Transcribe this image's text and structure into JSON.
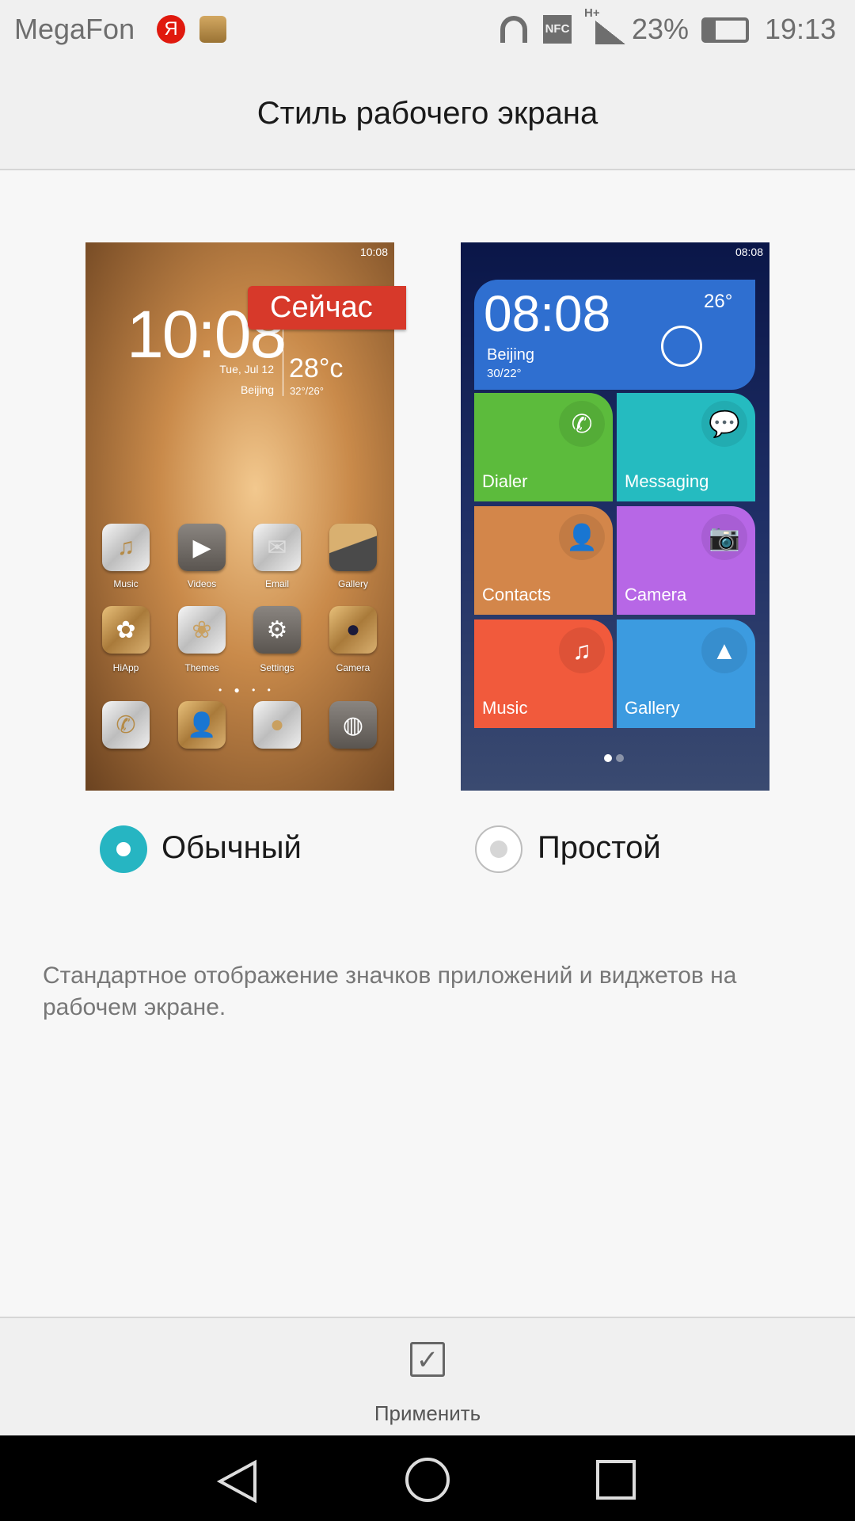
{
  "status_bar": {
    "carrier": "MegaFon",
    "yandex_badge": "Я",
    "battery": "23%",
    "network": "H+",
    "nfc": "NFC",
    "time": "19:13"
  },
  "header": {
    "title": "Стиль рабочего экрана"
  },
  "options": [
    {
      "label": "Обычный",
      "selected": true,
      "badge": "Сейчас",
      "preview": {
        "status_time": "10:08",
        "clock": "10:08",
        "date": "Tue, Jul 12",
        "city": "Beijing",
        "temp": "28°c",
        "range": "32°/26°",
        "apps": [
          "Music",
          "Videos",
          "Email",
          "Gallery",
          "HiApp",
          "Themes",
          "Settings",
          "Camera"
        ]
      }
    },
    {
      "label": "Простой",
      "selected": false,
      "preview": {
        "status_time": "08:08",
        "clock": "08:08",
        "city": "Beijing",
        "range": "30/22°",
        "temp": "26°",
        "tiles": [
          {
            "label": "Dialer",
            "color": "#5cbb3c"
          },
          {
            "label": "Messaging",
            "color": "#25bbc0"
          },
          {
            "label": "Contacts",
            "color": "#d3864a"
          },
          {
            "label": "Camera",
            "color": "#b767e6"
          },
          {
            "label": "Music",
            "color": "#f15a3c"
          },
          {
            "label": "Gallery",
            "color": "#3c9be0"
          }
        ]
      }
    }
  ],
  "description": "Стандартное отображение значков приложений и виджетов на рабочем экране.",
  "apply_label": "Применить",
  "accent": "#26b5c2"
}
